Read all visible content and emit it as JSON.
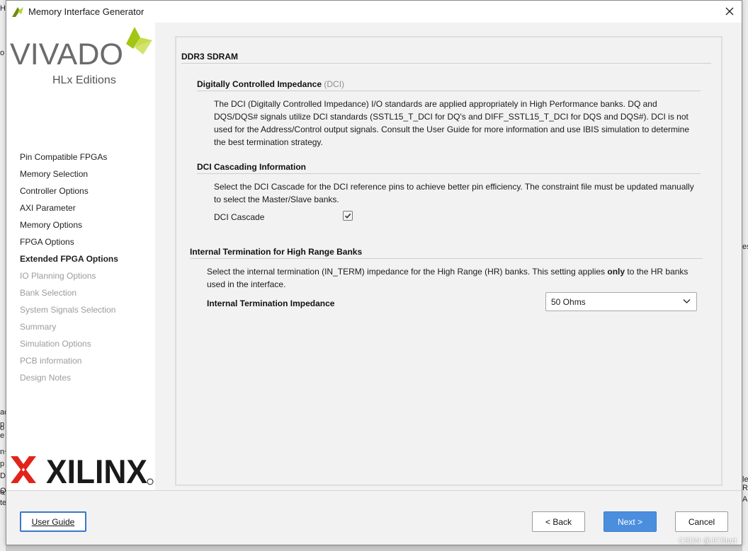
{
  "window": {
    "title": "Memory Interface Generator"
  },
  "background_app": {
    "left_fragments": [
      "H",
      "o",
      "ac",
      "p",
      "o g",
      "e",
      ". -",
      "n",
      "p",
      "DF",
      "Q",
      "e",
      "te"
    ],
    "right_fragments": [
      "es",
      "le",
      "R",
      "AM"
    ]
  },
  "branding": {
    "vivado_wordmark": "VIVADO",
    "vivado_edition": "HLx Editions",
    "xilinx_wordmark": "XILINX"
  },
  "sidebar": {
    "items": [
      {
        "label": "Pin Compatible FPGAs",
        "state": "done"
      },
      {
        "label": "Memory Selection",
        "state": "done"
      },
      {
        "label": "Controller Options",
        "state": "done"
      },
      {
        "label": "AXI Parameter",
        "state": "done"
      },
      {
        "label": "Memory Options",
        "state": "done"
      },
      {
        "label": "FPGA Options",
        "state": "done"
      },
      {
        "label": "Extended FPGA Options",
        "state": "active"
      },
      {
        "label": "IO Planning Options",
        "state": "disabled"
      },
      {
        "label": "Bank Selection",
        "state": "disabled"
      },
      {
        "label": "System Signals Selection",
        "state": "disabled"
      },
      {
        "label": "Summary",
        "state": "disabled"
      },
      {
        "label": "Simulation Options",
        "state": "disabled"
      },
      {
        "label": "PCB information",
        "state": "disabled"
      },
      {
        "label": "Design Notes",
        "state": "disabled"
      }
    ]
  },
  "main": {
    "header": "DDR3 SDRAM",
    "dci": {
      "title": "Digitally Controlled Impedance",
      "title_suffix": "(DCI)",
      "description": "The DCI (Digitally Controlled Impedance) I/O standards are applied appropriately in High Performance banks. DQ and DQS/DQS# signals utilize DCI standards (SSTL15_T_DCI for DQ's and DIFF_SSTL15_T_DCI for DQS and DQS#). DCI is not used for the Address/Control output signals. Consult the User Guide for more information and use IBIS simulation to determine the best termination strategy."
    },
    "cascade": {
      "title": "DCI Cascading Information",
      "description": "Select the DCI Cascade for the DCI reference pins to achieve better pin efficiency. The constraint file must be updated manually to select the Master/Slave banks.",
      "checkbox_label": "DCI Cascade",
      "checked": true
    },
    "internal_termination": {
      "title": "Internal Termination for High Range Banks",
      "description_pre": "Select the internal termination (IN_TERM) impedance for the High Range (HR) banks. This setting applies ",
      "description_bold": "only",
      "description_post": " to the HR banks used in the interface.",
      "field_label": "Internal Termination Impedance",
      "selected_value": "50 Ohms"
    }
  },
  "footer": {
    "user_guide": "User Guide",
    "back": "< Back",
    "next": "Next >",
    "cancel": "Cancel"
  },
  "watermark": "CSDN @JCStart",
  "colors": {
    "accent": "#4c8ede",
    "vivado_green": "#a2c613",
    "xilinx_red": "#e2231a",
    "disabled_text": "#9c9c9c"
  }
}
